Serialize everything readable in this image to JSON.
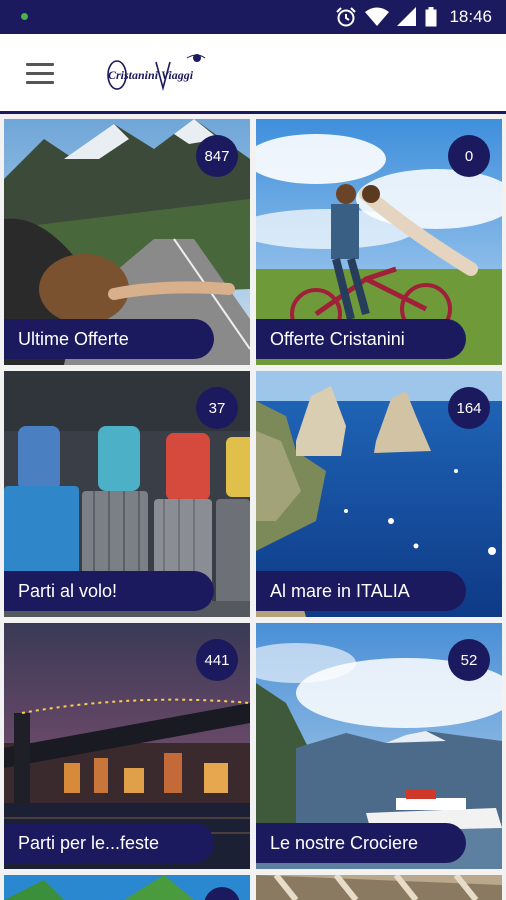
{
  "status_bar": {
    "time": "18:46",
    "icons": [
      "alarm-icon",
      "wifi-icon",
      "signal-icon",
      "battery-icon"
    ]
  },
  "app_bar": {
    "logo_text": "Cristanini Viaggi",
    "menu_icon": "hamburger-menu-icon"
  },
  "colors": {
    "primary": "#1c1a5e",
    "status_dot": "#4caf50",
    "background": "#f2f2f2"
  },
  "tiles": [
    {
      "label": "Ultime Offerte",
      "count": "847"
    },
    {
      "label": "Offerte Cristanini",
      "count": "0"
    },
    {
      "label": "Parti al volo!",
      "count": "37"
    },
    {
      "label": "Al mare in ITALIA",
      "count": "164"
    },
    {
      "label": "Parti per le...feste",
      "count": "441"
    },
    {
      "label": "Le nostre Crociere",
      "count": "52"
    }
  ]
}
